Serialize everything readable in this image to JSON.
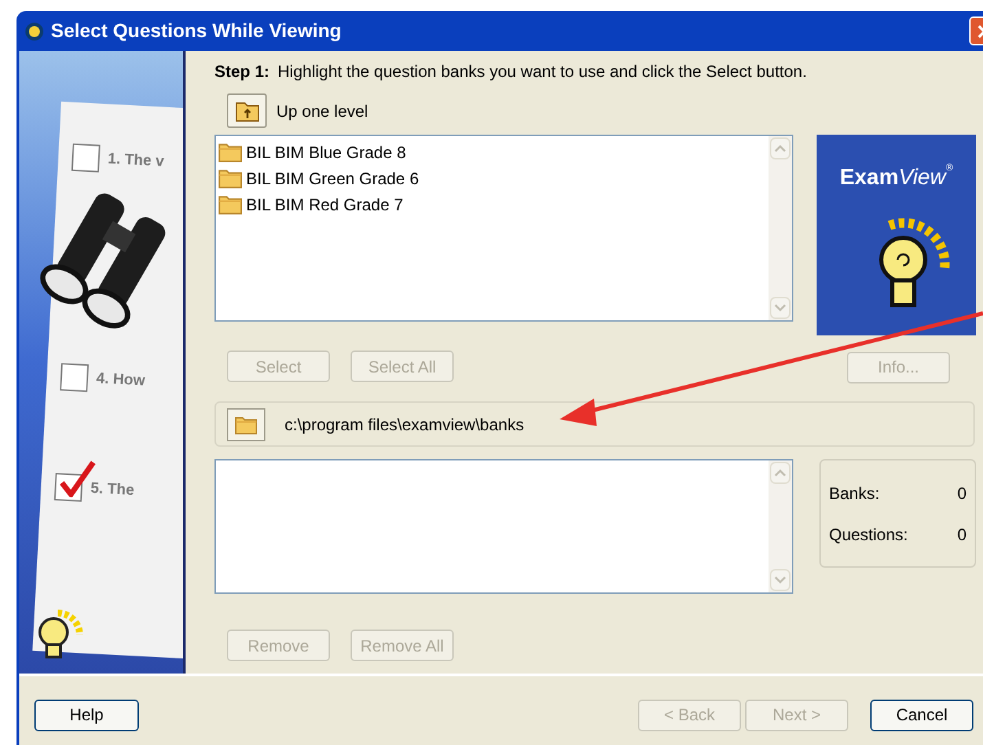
{
  "window": {
    "title": "Select Questions While Viewing"
  },
  "sidebar": {
    "items": [
      {
        "label": "1. The v",
        "checked": false
      },
      {
        "label": "4. How",
        "checked": false
      },
      {
        "label": "5. The",
        "checked": true
      }
    ]
  },
  "step": {
    "label": "Step 1:",
    "text": "Highlight the question banks you want to use and click the Select button."
  },
  "up_level": {
    "label": "Up one level"
  },
  "bank_list": [
    {
      "label": "BIL BIM Blue Grade 8"
    },
    {
      "label": "BIL BIM Green Grade 6"
    },
    {
      "label": "BIL BIM Red Grade 7"
    }
  ],
  "logo": {
    "text_bold": "Exam",
    "text_italic": "View",
    "mark": "®"
  },
  "list_buttons": [
    {
      "label": "Select",
      "disabled": true
    },
    {
      "label": "Select All",
      "disabled": true
    }
  ],
  "info_button": {
    "label": "Info...",
    "disabled": true
  },
  "path": {
    "value": "c:\\program files\\examview\\banks"
  },
  "stats": [
    {
      "label": "Banks:",
      "value": "0"
    },
    {
      "label": "Questions:",
      "value": "0"
    }
  ],
  "remove_buttons": [
    {
      "label": "Remove",
      "disabled": true
    },
    {
      "label": "Remove All",
      "disabled": true
    }
  ],
  "footer": {
    "help": {
      "label": "Help",
      "disabled": false
    },
    "nav": [
      {
        "label": "< Back",
        "disabled": true
      },
      {
        "label": "Next >",
        "disabled": true
      }
    ],
    "cancel": {
      "label": "Cancel",
      "disabled": false
    }
  }
}
